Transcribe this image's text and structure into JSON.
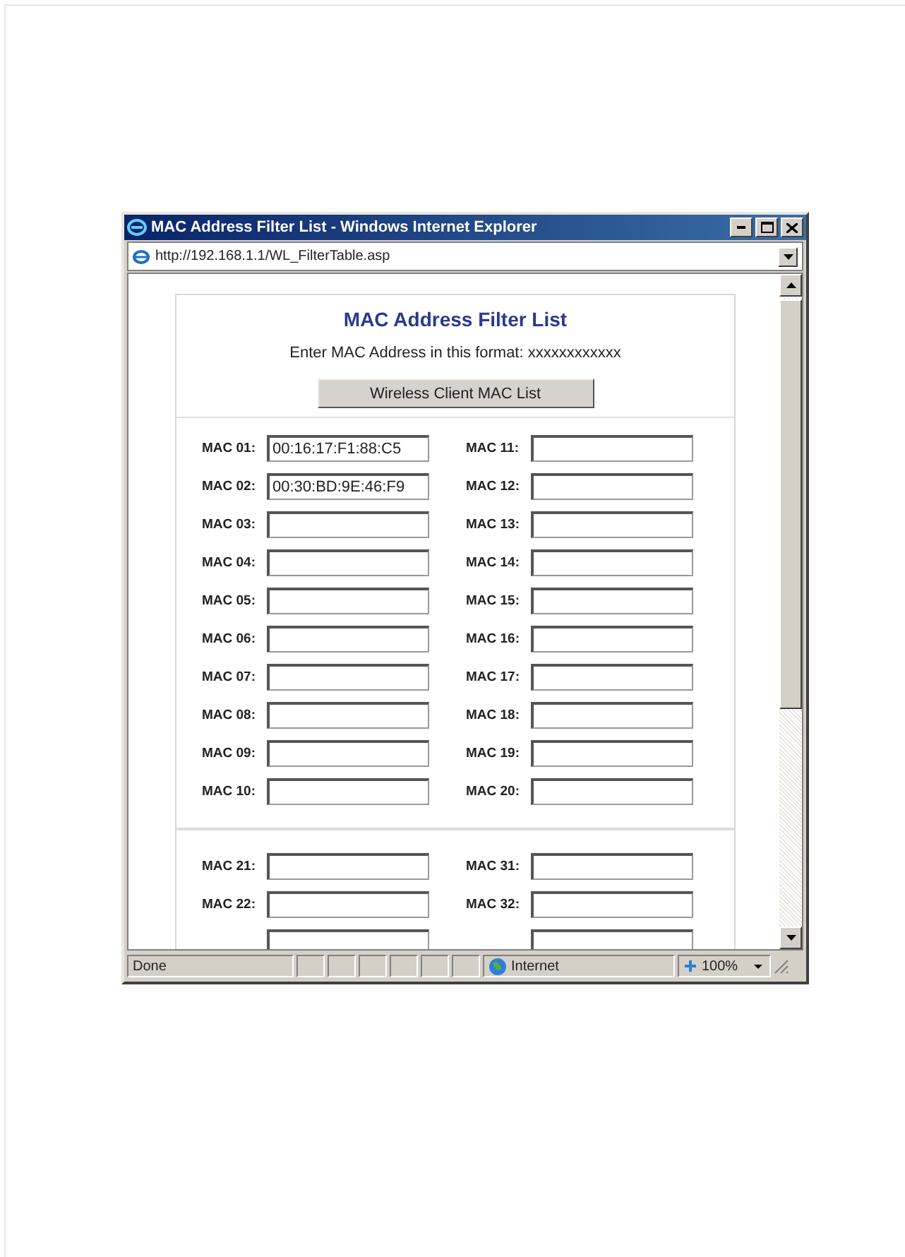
{
  "window": {
    "title": "MAC Address Filter List - Windows Internet Explorer",
    "address": "http://192.168.1.1/WL_FilterTable.asp"
  },
  "page": {
    "heading": "MAC Address Filter List",
    "instruction": "Enter MAC Address in this format: xxxxxxxxxxxx",
    "button": "Wireless Client MAC List",
    "groups": [
      {
        "rows": [
          {
            "kind": "field",
            "left": {
              "label": "MAC 01:",
              "value": "00:16:17:F1:88:C5"
            },
            "right": {
              "label": "MAC 11:"
            }
          },
          {
            "kind": "field",
            "left": {
              "label": "MAC 02:",
              "value": "00:30:BD:9E:46:F9"
            },
            "right": {
              "label": "MAC 12:"
            }
          },
          {
            "kind": "field",
            "left": {
              "label": "MAC 03:"
            },
            "right": {
              "label": "MAC 13:"
            }
          },
          {
            "kind": "field",
            "left": {
              "label": "MAC 04:"
            },
            "right": {
              "label": "MAC 14:"
            }
          },
          {
            "kind": "field",
            "left": {
              "label": "MAC 05:"
            },
            "right": {
              "label": "MAC 15:"
            }
          },
          {
            "kind": "field",
            "left": {
              "label": "MAC 06:"
            },
            "right": {
              "label": "MAC 16:"
            }
          },
          {
            "kind": "field",
            "left": {
              "label": "MAC 07:"
            },
            "right": {
              "label": "MAC 17:"
            }
          },
          {
            "kind": "field",
            "left": {
              "label": "MAC 08:"
            },
            "right": {
              "label": "MAC 18:"
            }
          },
          {
            "kind": "field",
            "left": {
              "label": "MAC 09:"
            },
            "right": {
              "label": "MAC 19:"
            }
          },
          {
            "kind": "field",
            "left": {
              "label": "MAC 10:"
            },
            "right": {
              "label": "MAC 20:"
            }
          }
        ]
      },
      {
        "rows": [
          {
            "kind": "field",
            "left": {
              "label": "MAC 21:"
            },
            "right": {
              "label": "MAC 31:"
            }
          },
          {
            "kind": "field",
            "left": {
              "label": "MAC 22:"
            },
            "right": {
              "label": "MAC 32:"
            }
          },
          {
            "kind": "cut"
          }
        ]
      }
    ]
  },
  "status_bar": {
    "text": "Done",
    "zone": "Internet",
    "zoom": "100%"
  }
}
